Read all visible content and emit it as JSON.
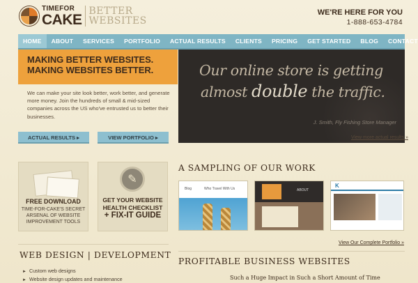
{
  "header": {
    "logo_top": "TIMEFOR",
    "logo_big": "CAKE",
    "tagline_1": "BETTER",
    "tagline_2": "WEBSITES",
    "contact_title": "WE'RE HERE FOR YOU",
    "contact_phone": "1-888-653-4784"
  },
  "nav": {
    "items": [
      "HOME",
      "ABOUT",
      "SERVICES",
      "PORTFOLIO",
      "ACTUAL RESULTS",
      "CLIENTS",
      "PRICING",
      "GET STARTED",
      "BLOG",
      "CONTACT"
    ],
    "active": "HOME"
  },
  "hero": {
    "headline_1": "MAKING BETTER WEBSITES.",
    "headline_2": "MAKING WEBSITES BETTER.",
    "copy": "We can make your site look better, work better, and generate more money. Join the hundreds of small & mid-sized companies across the US who've entrusted us to better their businesses.",
    "btn_actual": "ACTUAL RESULTS ▸",
    "btn_portfolio": "VIEW PORTFOLIO ▸"
  },
  "testimonial": {
    "line1": "Our online store is getting",
    "line2_pre": "almost ",
    "line2_strong": "double",
    "line2_post": " the traffic.",
    "attribution": "J. Smith, Fly Fishing Store Manager",
    "link": "View more actual results »"
  },
  "promos": {
    "download_title": "FREE DOWNLOAD",
    "download_text": "TIME-FOR-CAKE'S SECRET ARSENAL OF WEBSITE IMPROVEMENT TOOLS",
    "checklist_1": "GET YOUR WEBSITE",
    "checklist_2": "HEALTH CHECKLIST",
    "checklist_3": "+ FIX-IT GUIDE"
  },
  "sampling": {
    "title": "A SAMPLING OF OUR WORK",
    "thumb1_nav_1": "Blog",
    "thumb1_nav_2": "Who Travel With Us",
    "thumb2_about": "ABOUT",
    "thumb3_logo": "K",
    "link": "View Our Complete Portfolio »"
  },
  "bottom": {
    "web_title": "WEB DESIGN | DEVELOPMENT",
    "bullets": [
      "Custom web designs",
      "Website design updates and maintenance"
    ],
    "profit_title": "PROFITABLE BUSINESS WEBSITES",
    "profit_sub": "Such a Huge Impact in Such a Short Amount of Time"
  },
  "colors": {
    "nav": "#7fb5c4",
    "accent": "#eea13c",
    "dark": "#2e2a27",
    "background": "#f3ecd6"
  }
}
